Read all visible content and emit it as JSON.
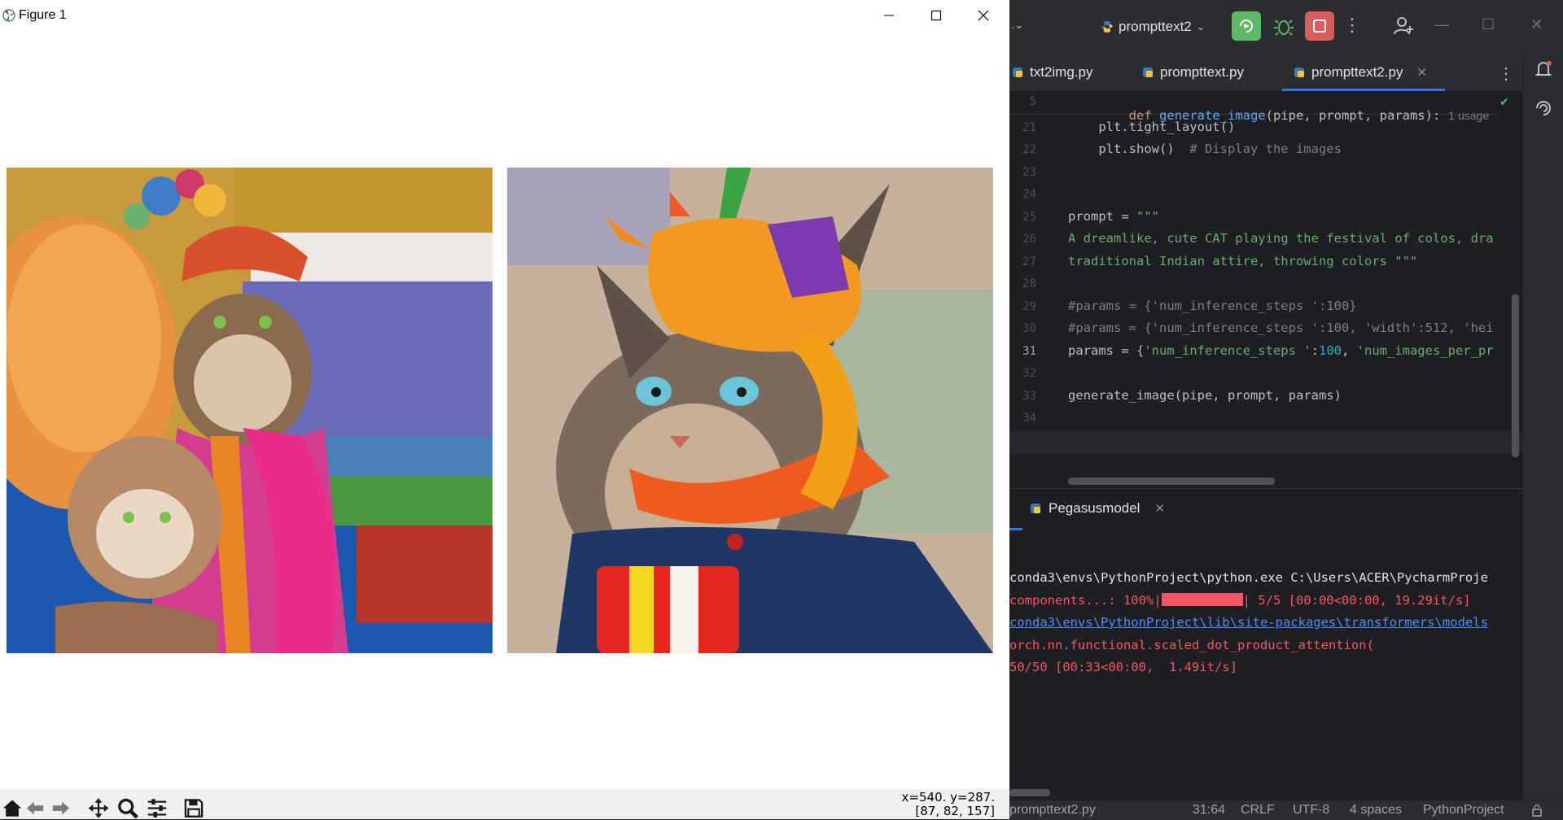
{
  "figure": {
    "title": "Figure 1",
    "coords_line1": "x=540. y=287.",
    "coords_line2": "[87, 82, 157]"
  },
  "ide": {
    "run_config": "prompttext2",
    "tabs": [
      {
        "label": "txt2img.py"
      },
      {
        "label": "prompttext.py"
      },
      {
        "label": "prompttext2.py"
      }
    ],
    "sticky": {
      "line": "5",
      "kw": "def",
      "fn": "generate_image",
      "args": "(pipe, prompt, params):",
      "usage": "1 usage"
    },
    "lines": [
      {
        "num": "21",
        "text": "    plt.tight_layout()"
      },
      {
        "num": "22",
        "text": "    plt.show()  ",
        "comment": "# Display the images"
      },
      {
        "num": "23",
        "text": ""
      },
      {
        "num": "24",
        "text": ""
      },
      {
        "num": "25",
        "text": "prompt = ",
        "str": "\"\"\""
      },
      {
        "num": "26",
        "str": "A dreamlike, cute CAT playing the festival of colos, dra"
      },
      {
        "num": "27",
        "str": "traditional Indian attire, throwing colors \"\"\""
      },
      {
        "num": "28",
        "text": ""
      },
      {
        "num": "29",
        "comment": "#params = {'num_inference_steps ':100}"
      },
      {
        "num": "30",
        "comment": "#params = {'num_inference_steps ':100, 'width':512, 'hei"
      },
      {
        "num": "31",
        "text_a": "params = {",
        "str_a": "'num_inference_steps '",
        "text_b": ":",
        "num_val": "100",
        "text_c": ", ",
        "str_b": "'num_images_per_pr"
      },
      {
        "num": "32",
        "text": ""
      },
      {
        "num": "33",
        "text": "generate_image(pipe, prompt, params)"
      },
      {
        "num": "34",
        "text": ""
      }
    ],
    "run_tab": "Pegasusmodel",
    "console": [
      {
        "type": "out",
        "text": "conda3\\envs\\PythonProject\\python.exe C:\\Users\\ACER\\PycharmProje"
      },
      {
        "type": "progress",
        "pre": "components...: 100%|",
        "post": "| 5/5 [00:00<00:00, 19.29it/s]"
      },
      {
        "type": "link",
        "text": "conda3\\envs\\PythonProject\\lib\\site-packages\\transformers\\models"
      },
      {
        "type": "err",
        "text": "orch.nn.functional.scaled_dot_product_attention("
      },
      {
        "type": "err",
        "text": "50/50 [00:33<00:00,  1.49it/s]"
      }
    ],
    "status": {
      "file": "prompttext2.py",
      "position": "31:64",
      "line_sep": "CRLF",
      "encoding": "UTF-8",
      "indent": "4 spaces",
      "interpreter": "PythonProject"
    }
  },
  "colors": {
    "accent": "#3574f0",
    "run_green": "#5fb865",
    "stop_red": "#db5c5c",
    "error_red": "#f75464"
  }
}
